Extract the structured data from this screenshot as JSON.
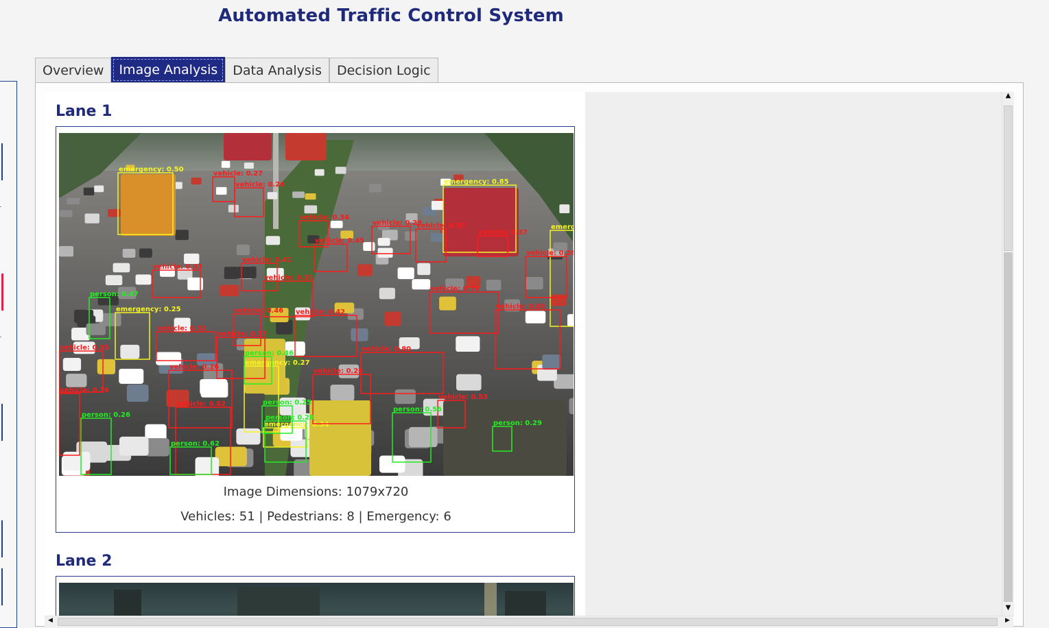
{
  "app": {
    "title": "Automated Traffic Control System"
  },
  "tabs": [
    {
      "label": "Overview",
      "active": false
    },
    {
      "label": "Image Analysis",
      "active": true
    },
    {
      "label": "Data Analysis",
      "active": false
    },
    {
      "label": "Decision Logic",
      "active": false
    }
  ],
  "lanes": [
    {
      "title": "Lane 1",
      "image_dimensions": "Image Dimensions: 1079x720",
      "counts": "Vehicles: 51 | Pedestrians: 8 | Emergency: 6",
      "detections": [
        {
          "label": "emergency: 0.50",
          "cls": "emergency"
        },
        {
          "label": "emergency: 0.85",
          "cls": "emergency"
        },
        {
          "label": "emergency: 0.25",
          "cls": "emergency"
        },
        {
          "label": "emergency: 0.27",
          "cls": "emergency"
        },
        {
          "label": "emergency: 0.34",
          "cls": "emergency"
        },
        {
          "label": "emerg",
          "cls": "emergency"
        },
        {
          "label": "vehicle: 0.27",
          "cls": "vehicle"
        },
        {
          "label": "vehicle: 0.26",
          "cls": "vehicle"
        },
        {
          "label": "vehicle: 0.34",
          "cls": "vehicle"
        },
        {
          "label": "vehicle: 0.29",
          "cls": "vehicle"
        },
        {
          "label": "vehicle: 0.57",
          "cls": "vehicle"
        },
        {
          "label": "vehicle: 0.37",
          "cls": "vehicle"
        },
        {
          "label": "vehicle: 0.45",
          "cls": "vehicle"
        },
        {
          "label": "vehicle: 0.41",
          "cls": "vehicle"
        },
        {
          "label": "vehicle: 0.31",
          "cls": "vehicle"
        },
        {
          "label": "vehicle: 0.46",
          "cls": "vehicle"
        },
        {
          "label": "vehicle: 0.42",
          "cls": "vehicle"
        },
        {
          "label": "vehicle: 0.32",
          "cls": "vehicle"
        },
        {
          "label": "vehicle: 0.37",
          "cls": "vehicle"
        },
        {
          "label": "vehicle: 0.80",
          "cls": "vehicle"
        },
        {
          "label": "vehicle: 0.53",
          "cls": "vehicle"
        },
        {
          "label": "vehicle: 0.26",
          "cls": "vehicle"
        },
        {
          "label": "vehicle: 0.35",
          "cls": "vehicle"
        },
        {
          "label": "vehicle: 0.36",
          "cls": "vehicle"
        },
        {
          "label": "vehicle: 0.26",
          "cls": "vehicle"
        },
        {
          "label": "vehicle: 0.82",
          "cls": "vehicle"
        },
        {
          "label": "vehicle: 0.33",
          "cls": "vehicle"
        },
        {
          "label": "vehicle: 0.76",
          "cls": "vehicle"
        },
        {
          "label": "vehicle: 0.83",
          "cls": "vehicle"
        },
        {
          "label": "vehicle: 0.26",
          "cls": "vehicle"
        },
        {
          "label": "person: 0.25",
          "cls": "person"
        },
        {
          "label": "person: 0.28",
          "cls": "person"
        },
        {
          "label": "person: 0.62",
          "cls": "person"
        },
        {
          "label": "person: 0.29",
          "cls": "person"
        },
        {
          "label": "person: 0.56",
          "cls": "person"
        },
        {
          "label": "person: 0.47",
          "cls": "person"
        },
        {
          "label": "person: 0.46",
          "cls": "person"
        },
        {
          "label": "person: 0.26",
          "cls": "person"
        }
      ]
    },
    {
      "title": "Lane 2"
    }
  ],
  "colors": {
    "accent": "#1f2a85",
    "title": "#1f2a7a",
    "vehicle": "#ff1a1a",
    "person": "#22ee22",
    "emergency": "#f5f522"
  },
  "icons": {
    "scroll_up": "▲",
    "scroll_down": "▼",
    "scroll_left": "◀",
    "scroll_right": "▶"
  }
}
